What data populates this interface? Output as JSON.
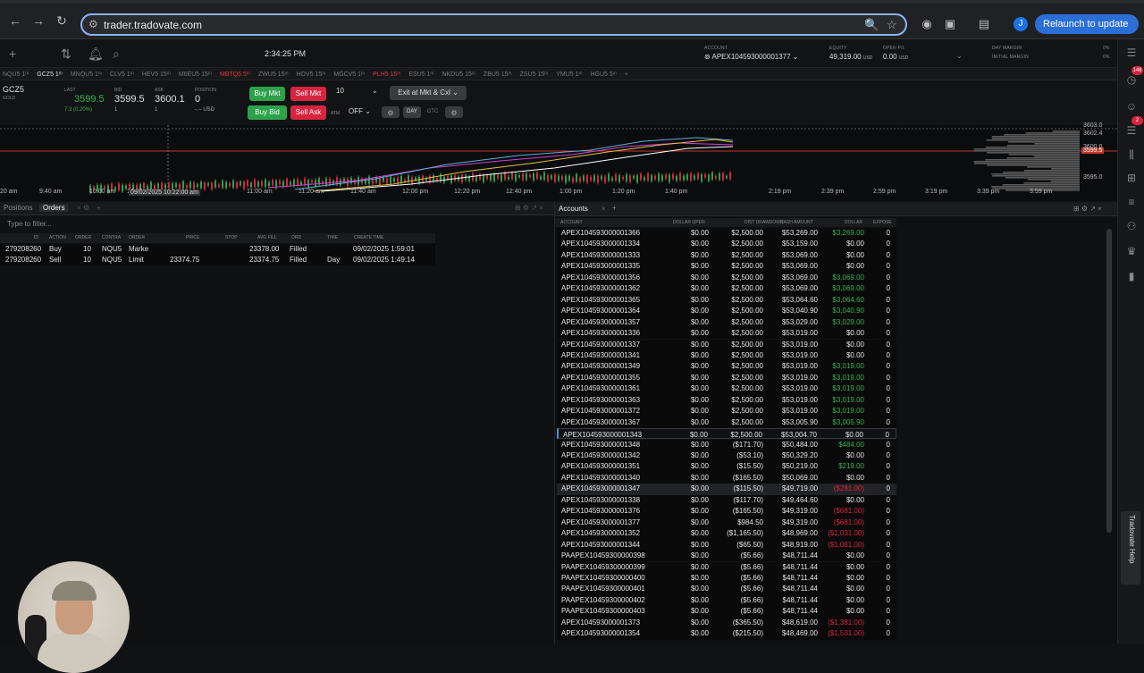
{
  "browser": {
    "url": "trader.tradovate.com",
    "profile_initial": "J",
    "relaunch_label": "Relaunch to update"
  },
  "header": {
    "clock": "2:34:25 PM",
    "account_label": "ACCOUNT",
    "account_value": "APEX104593000001377",
    "equity_label": "EQUITY",
    "equity_value": "49,319.00",
    "equity_unit": "USD",
    "openpl_label": "OPEN P/L",
    "openpl_value": "0.00",
    "openpl_unit": "USD",
    "day_margin_label": "DAY MARGIN",
    "day_margin_value": "0%",
    "initial_margin_label": "INITIAL MARGIN",
    "initial_margin_value": "0%"
  },
  "symbols": [
    {
      "label": "NQU5 1ᵐ",
      "style": "normal"
    },
    {
      "label": "GCZ5 1ᵐ",
      "style": "active"
    },
    {
      "label": "MNQU5 1ᵐ",
      "style": "normal"
    },
    {
      "label": "CLV5 1ᵐ",
      "style": "normal"
    },
    {
      "label": "HEV5 15ᵐ",
      "style": "normal"
    },
    {
      "label": "M6EU5 15ᵐ",
      "style": "normal"
    },
    {
      "label": "MBTQ5 5ᵐ",
      "style": "red"
    },
    {
      "label": "ZWU5 15ᵐ",
      "style": "normal"
    },
    {
      "label": "HOV5 15ᵐ",
      "style": "normal"
    },
    {
      "label": "MGCV5 1ᵐ",
      "style": "normal"
    },
    {
      "label": "PLH5 15ᵐ",
      "style": "red"
    },
    {
      "label": "ESU5 1ᵐ",
      "style": "normal"
    },
    {
      "label": "NKDU5 15ᵐ",
      "style": "normal"
    },
    {
      "label": "ZBU5 15ᵐ",
      "style": "normal"
    },
    {
      "label": "ZSU5 15ᵐ",
      "style": "normal"
    },
    {
      "label": "YMU5 1ᵐ",
      "style": "normal"
    },
    {
      "label": "HGU5 5ᵐ",
      "style": "normal"
    },
    {
      "label": "+",
      "style": "normal"
    }
  ],
  "quote": {
    "symbol": "GCZ5",
    "symbol_sub": "GOLD",
    "last_label": "LAST",
    "last_value": "3599.5",
    "last_change": "7.3 (0.20%)",
    "bid_label": "BID",
    "bid_value": "3599.5",
    "bid_size": "1",
    "ask_label": "ASK",
    "ask_value": "3600.1",
    "ask_size": "1",
    "position_label": "POSITION",
    "position_value": "0",
    "position_sub": "-.-- USD",
    "buy_mkt": "Buy Mkt",
    "sell_mkt": "Sell Mkt",
    "buy_bid": "Buy Bid",
    "sell_ask": "Sell Ask",
    "qty": "10",
    "exit_label": "Exit at Mkt & Cxl",
    "atm_label": "ATM",
    "atm_value": "OFF",
    "day_label": "DAY",
    "gtc_label": "GTC"
  },
  "chart": {
    "x_ticks": [
      "20 am",
      "9:40 am",
      "10:00 am",
      "10:20 am",
      "11:00 am",
      "11:20 am",
      "11:40 am",
      "12:00 pm",
      "12:20 pm",
      "12:40 pm",
      "1:00 pm",
      "1:20 pm",
      "1:40 pm",
      "2:19 pm",
      "2:39 pm",
      "2:59 pm",
      "3:19 pm",
      "3:39 pm",
      "3:59 pm"
    ],
    "cursor_label": "09/02/2025 10:22:00 am",
    "price_top": "3603.0",
    "price_mid": "3599.5",
    "price_low": "3595.0",
    "price_hi2": "3602.4",
    "price_mid2": "3600.0"
  },
  "left_panel": {
    "tab_positions": "Positions",
    "tab_orders": "Orders",
    "filter_placeholder": "Type to filter...",
    "headers": [
      "ID",
      "ACTION",
      "ORDER",
      "CONTRA",
      "ORDER",
      "PRICE",
      "STOP",
      "AVG FILL",
      "ORD",
      "TIME",
      "CREATE TIME"
    ],
    "rows": [
      {
        "id": "279208260",
        "action": "Buy",
        "qty": "10",
        "contract": "NQU5",
        "type": "Marke",
        "price": "",
        "stop": "",
        "avg": "23378.00",
        "status": "Filled",
        "tif": "",
        "time": "09/02/2025 1:59:01"
      },
      {
        "id": "279208260",
        "action": "Sell",
        "qty": "10",
        "contract": "NQU5",
        "type": "Limit",
        "price": "23374.75",
        "stop": "",
        "avg": "23374.75",
        "status": "Filled",
        "tif": "Day",
        "time": "09/02/2025 1:49:14"
      }
    ]
  },
  "accounts_panel": {
    "tab": "Accounts",
    "headers": [
      "ACCOUNT",
      "DOLLAR OPEN",
      "DIST DRAWDOWN",
      "CASH AMOUNT",
      "DOLLAR",
      "EXPOSE"
    ],
    "rows": [
      {
        "acct": "APEX104593000001366",
        "open": "$0.00",
        "dd": "$2,500.00",
        "cash": "$53,269.00",
        "dollar": "$3,269.00",
        "tone": "pos",
        "exp": "0"
      },
      {
        "acct": "APEX104593000001334",
        "open": "$0.00",
        "dd": "$2,500.00",
        "cash": "$53,159.00",
        "dollar": "$0.00",
        "tone": "",
        "exp": "0"
      },
      {
        "acct": "APEX104593000001333",
        "open": "$0.00",
        "dd": "$2,500.00",
        "cash": "$53,069.00",
        "dollar": "$0.00",
        "tone": "",
        "exp": "0"
      },
      {
        "acct": "APEX104593000001335",
        "open": "$0.00",
        "dd": "$2,500.00",
        "cash": "$53,069.00",
        "dollar": "$0.00",
        "tone": "",
        "exp": "0"
      },
      {
        "acct": "APEX104593000001356",
        "open": "$0.00",
        "dd": "$2,500.00",
        "cash": "$53,069.00",
        "dollar": "$3,069.00",
        "tone": "pos",
        "exp": "0"
      },
      {
        "acct": "APEX104593000001362",
        "open": "$0.00",
        "dd": "$2,500.00",
        "cash": "$53,069.00",
        "dollar": "$3,069.00",
        "tone": "pos",
        "exp": "0"
      },
      {
        "acct": "APEX104593000001365",
        "open": "$0.00",
        "dd": "$2,500.00",
        "cash": "$53,064.60",
        "dollar": "$3,064.60",
        "tone": "pos",
        "exp": "0"
      },
      {
        "acct": "APEX104593000001364",
        "open": "$0.00",
        "dd": "$2,500.00",
        "cash": "$53,040.90",
        "dollar": "$3,040.90",
        "tone": "pos",
        "exp": "0"
      },
      {
        "acct": "APEX104593000001357",
        "open": "$0.00",
        "dd": "$2,500.00",
        "cash": "$53,029.00",
        "dollar": "$3,029.00",
        "tone": "pos",
        "exp": "0"
      },
      {
        "acct": "APEX104593000001336",
        "open": "$0.00",
        "dd": "$2,500.00",
        "cash": "$53,019.00",
        "dollar": "$0.00",
        "tone": "",
        "exp": "0"
      },
      {
        "acct": "APEX104593000001337",
        "open": "$0.00",
        "dd": "$2,500.00",
        "cash": "$53,019.00",
        "dollar": "$0.00",
        "tone": "",
        "exp": "0"
      },
      {
        "acct": "APEX104593000001341",
        "open": "$0.00",
        "dd": "$2,500.00",
        "cash": "$53,019.00",
        "dollar": "$0.00",
        "tone": "",
        "exp": "0"
      },
      {
        "acct": "APEX104593000001349",
        "open": "$0.00",
        "dd": "$2,500.00",
        "cash": "$53,019.00",
        "dollar": "$3,019.00",
        "tone": "pos",
        "exp": "0"
      },
      {
        "acct": "APEX104593000001355",
        "open": "$0.00",
        "dd": "$2,500.00",
        "cash": "$53,019.00",
        "dollar": "$3,019.00",
        "tone": "pos",
        "exp": "0"
      },
      {
        "acct": "APEX104593000001361",
        "open": "$0.00",
        "dd": "$2,500.00",
        "cash": "$53,019.00",
        "dollar": "$3,019.00",
        "tone": "pos",
        "exp": "0"
      },
      {
        "acct": "APEX104593000001363",
        "open": "$0.00",
        "dd": "$2,500.00",
        "cash": "$53,019.00",
        "dollar": "$3,019.00",
        "tone": "pos",
        "exp": "0"
      },
      {
        "acct": "APEX104593000001372",
        "open": "$0.00",
        "dd": "$2,500.00",
        "cash": "$53,019.00",
        "dollar": "$3,019.00",
        "tone": "pos",
        "exp": "0"
      },
      {
        "acct": "APEX104593000001367",
        "open": "$0.00",
        "dd": "$2,500.00",
        "cash": "$53,005.90",
        "dollar": "$3,005.90",
        "tone": "pos",
        "exp": "0"
      },
      {
        "acct": "APEX104593000001343",
        "open": "$0.00",
        "dd": "$2,500.00",
        "cash": "$53,004.70",
        "dollar": "$0.00",
        "tone": "",
        "exp": "0",
        "selected": true
      },
      {
        "acct": "APEX104593000001348",
        "open": "$0.00",
        "dd": "($171.70)",
        "cash": "$50,484.00",
        "dollar": "$484.00",
        "tone": "pos",
        "exp": "0"
      },
      {
        "acct": "APEX104593000001342",
        "open": "$0.00",
        "dd": "($53.10)",
        "cash": "$50,329.20",
        "dollar": "$0.00",
        "tone": "",
        "exp": "0"
      },
      {
        "acct": "APEX104593000001351",
        "open": "$0.00",
        "dd": "($15.50)",
        "cash": "$50,219.00",
        "dollar": "$219.00",
        "tone": "pos",
        "exp": "0"
      },
      {
        "acct": "APEX104593000001340",
        "open": "$0.00",
        "dd": "($165.50)",
        "cash": "$50,069.00",
        "dollar": "$0.00",
        "tone": "",
        "exp": "0"
      },
      {
        "acct": "APEX104593000001347",
        "open": "$0.00",
        "dd": "($115.50)",
        "cash": "$49,719.00",
        "dollar": "($281.00)",
        "tone": "neg",
        "exp": "0",
        "hover": true
      },
      {
        "acct": "APEX104593000001338",
        "open": "$0.00",
        "dd": "($117.70)",
        "cash": "$49,464.60",
        "dollar": "$0.00",
        "tone": "",
        "exp": "0"
      },
      {
        "acct": "APEX104593000001376",
        "open": "$0.00",
        "dd": "($165.50)",
        "cash": "$49,319.00",
        "dollar": "($681.00)",
        "tone": "neg",
        "exp": "0"
      },
      {
        "acct": "APEX104593000001377",
        "open": "$0.00",
        "dd": "$984.50",
        "cash": "$49,319.00",
        "dollar": "($681.00)",
        "tone": "neg",
        "exp": "0"
      },
      {
        "acct": "APEX104593000001352",
        "open": "$0.00",
        "dd": "($1,165.50)",
        "cash": "$48,969.00",
        "dollar": "($1,031.00)",
        "tone": "neg",
        "exp": "0"
      },
      {
        "acct": "APEX104593000001344",
        "open": "$0.00",
        "dd": "($65.50)",
        "cash": "$48,919.00",
        "dollar": "($1,081.00)",
        "tone": "neg",
        "exp": "0"
      },
      {
        "acct": "PAAPEX10459300000398",
        "open": "$0.00",
        "dd": "($5.66)",
        "cash": "$48,711.44",
        "dollar": "$0.00",
        "tone": "",
        "exp": "0"
      },
      {
        "acct": "PAAPEX10459300000399",
        "open": "$0.00",
        "dd": "($5.66)",
        "cash": "$48,711.44",
        "dollar": "$0.00",
        "tone": "",
        "exp": "0"
      },
      {
        "acct": "PAAPEX10459300000400",
        "open": "$0.00",
        "dd": "($5.66)",
        "cash": "$48,711.44",
        "dollar": "$0.00",
        "tone": "",
        "exp": "0"
      },
      {
        "acct": "PAAPEX10459300000401",
        "open": "$0.00",
        "dd": "($5.66)",
        "cash": "$48,711.44",
        "dollar": "$0.00",
        "tone": "",
        "exp": "0"
      },
      {
        "acct": "PAAPEX10459300000402",
        "open": "$0.00",
        "dd": "($5.66)",
        "cash": "$48,711.44",
        "dollar": "$0.00",
        "tone": "",
        "exp": "0"
      },
      {
        "acct": "PAAPEX10459300000403",
        "open": "$0.00",
        "dd": "($5.66)",
        "cash": "$48,711.44",
        "dollar": "$0.00",
        "tone": "",
        "exp": "0"
      },
      {
        "acct": "APEX104593000001373",
        "open": "$0.00",
        "dd": "($365.50)",
        "cash": "$48,619.00",
        "dollar": "($1,381.00)",
        "tone": "neg",
        "exp": "0"
      },
      {
        "acct": "APEX104593000001354",
        "open": "$0.00",
        "dd": "($215.50)",
        "cash": "$48,469.00",
        "dollar": "($1,531.00)",
        "tone": "neg",
        "exp": "0"
      }
    ]
  },
  "sidebar": {
    "badge1": "148",
    "badge2": "2",
    "help_label": "Tradovate Help"
  },
  "colors": {
    "buy_green": "#2da24a",
    "sell_red": "#d8243e",
    "profit_green": "#36b34e",
    "loss_red": "#d8243e",
    "accent_blue": "#8ab4f8"
  }
}
